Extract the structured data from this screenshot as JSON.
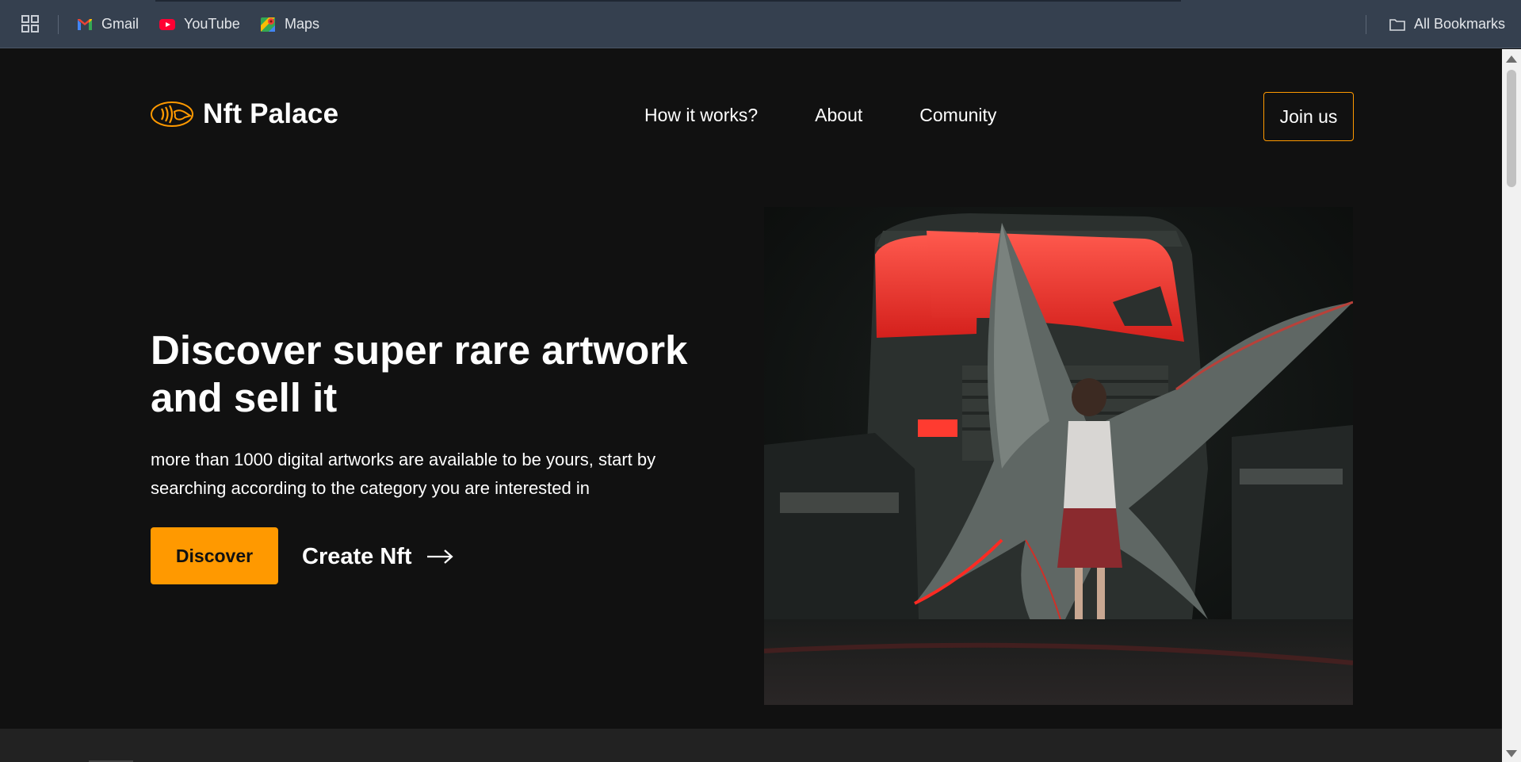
{
  "bookmarks_bar": {
    "items": [
      {
        "label": "Gmail",
        "icon": "gmail-icon"
      },
      {
        "label": "YouTube",
        "icon": "youtube-icon"
      },
      {
        "label": "Maps",
        "icon": "maps-icon"
      }
    ],
    "all_bookmarks_label": "All Bookmarks"
  },
  "site": {
    "logo_text": "Nft Palace",
    "nav": [
      "How it works?",
      "About",
      "Comunity"
    ],
    "join_label": "Join us"
  },
  "hero": {
    "title": "Discover super rare artwork and sell it",
    "description": "more than 1000 digital artworks are available to be yours, start by searching according to the category you are interested in",
    "discover_label": "Discover",
    "create_label": "Create Nft"
  },
  "colors": {
    "accent": "#ff9900",
    "background": "#111111",
    "bookmarks_bar": "#35404f"
  }
}
